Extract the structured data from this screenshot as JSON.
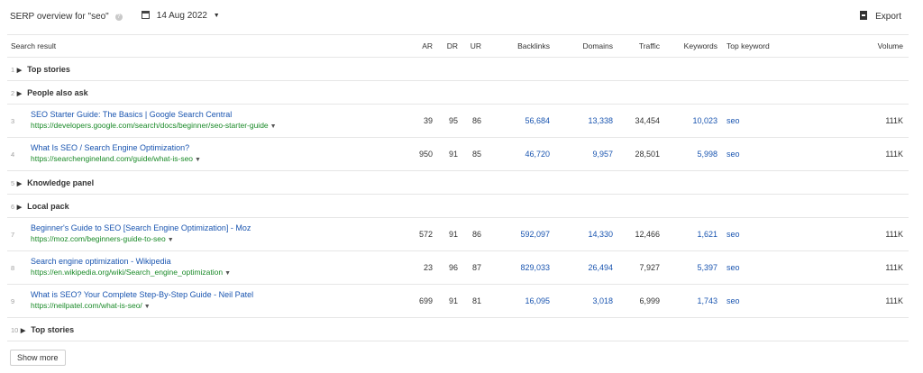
{
  "header": {
    "title": "SERP overview for \"seo\"",
    "help_glyph": "?",
    "date": "14 Aug 2022",
    "export_label": "Export"
  },
  "columns": {
    "result": "Search result",
    "ar": "AR",
    "dr": "DR",
    "ur": "UR",
    "backlinks": "Backlinks",
    "domains": "Domains",
    "traffic": "Traffic",
    "keywords": "Keywords",
    "top_keyword": "Top keyword",
    "volume": "Volume"
  },
  "rows": [
    {
      "pos": "1",
      "label": "Top stories"
    },
    {
      "pos": "2",
      "label": "People also ask"
    },
    {
      "pos": "3",
      "title": "SEO Starter Guide: The Basics | Google Search Central",
      "url": "https://developers.google.com/search/docs/beginner/seo-starter-guide",
      "ar": "39",
      "dr": "95",
      "ur": "86",
      "backlinks": "56,684",
      "domains": "13,338",
      "traffic": "34,454",
      "keywords": "10,023",
      "top_keyword": "seo",
      "volume": "111K"
    },
    {
      "pos": "4",
      "title": "What Is SEO / Search Engine Optimization?",
      "url": "https://searchengineland.com/guide/what-is-seo",
      "ar": "950",
      "dr": "91",
      "ur": "85",
      "backlinks": "46,720",
      "domains": "9,957",
      "traffic": "28,501",
      "keywords": "5,998",
      "top_keyword": "seo",
      "volume": "111K"
    },
    {
      "pos": "5",
      "label": "Knowledge panel"
    },
    {
      "pos": "6",
      "label": "Local pack"
    },
    {
      "pos": "7",
      "title": "Beginner's Guide to SEO [Search Engine Optimization] - Moz",
      "url": "https://moz.com/beginners-guide-to-seo",
      "ar": "572",
      "dr": "91",
      "ur": "86",
      "backlinks": "592,097",
      "domains": "14,330",
      "traffic": "12,466",
      "keywords": "1,621",
      "top_keyword": "seo",
      "volume": "111K"
    },
    {
      "pos": "8",
      "title": "Search engine optimization - Wikipedia",
      "url": "https://en.wikipedia.org/wiki/Search_engine_optimization",
      "ar": "23",
      "dr": "96",
      "ur": "87",
      "backlinks": "829,033",
      "domains": "26,494",
      "traffic": "7,927",
      "keywords": "5,397",
      "top_keyword": "seo",
      "volume": "111K"
    },
    {
      "pos": "9",
      "title": "What is SEO? Your Complete Step-By-Step Guide - Neil Patel",
      "url": "https://neilpatel.com/what-is-seo/",
      "ar": "699",
      "dr": "91",
      "ur": "81",
      "backlinks": "16,095",
      "domains": "3,018",
      "traffic": "6,999",
      "keywords": "1,743",
      "top_keyword": "seo",
      "volume": "111K"
    },
    {
      "pos": "10",
      "label": "Top stories"
    }
  ],
  "show_more_label": "Show more",
  "colors": {
    "link": "#1a55b0",
    "url": "#1a8a28",
    "muted": "#a0a0a0",
    "border": "#e6e6e6"
  },
  "icons": {
    "date": "calendar-icon",
    "export": "export-icon",
    "help": "help-icon",
    "expand": "triangle-right-icon"
  }
}
